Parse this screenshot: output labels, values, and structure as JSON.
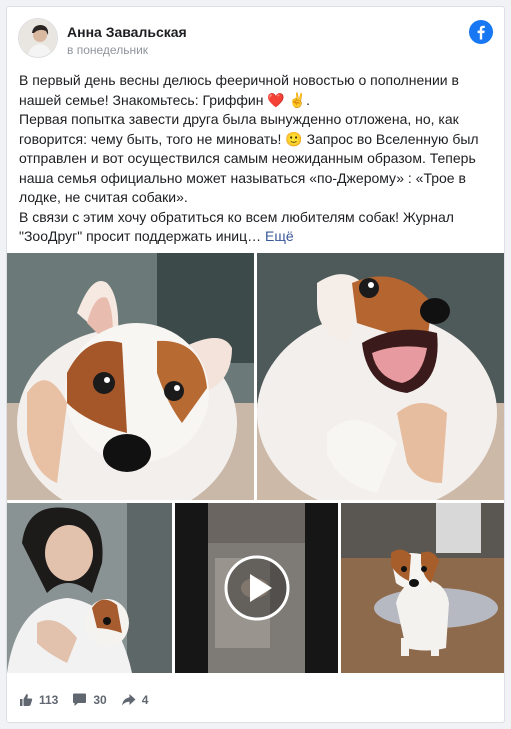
{
  "author": {
    "name": "Анна Завальская",
    "time": "в понедельник"
  },
  "post": {
    "line1": "В первый день весны делюсь фееричной новостью о пополнении в нашей семье! Знакомьтесь: Гриффин ❤️ ✌️.",
    "line2": "Первая попытка завести друга была вынужденно отложена, но, как говорится: чему быть, того не миновать! 🙂 Запрос во Вселенную был отправлен и вот осуществился самым неожиданным образом. Теперь наша семья официально может называться «по-Джерому» : «Трое в лодке, не считая собаки».",
    "line3": "В связи с этим хочу обратиться ко всем любителям собак! Журнал \"ЗооДруг\" просит поддержать иниц…",
    "more": "Ещё"
  },
  "stats": {
    "likes": "113",
    "comments": "30",
    "shares": "4"
  },
  "colors": {
    "facebook": "#1877f2",
    "link": "#385898",
    "text": "#1c1e21",
    "muted": "#90949c"
  },
  "icons": [
    "facebook-icon",
    "like-icon",
    "comment-icon",
    "share-icon",
    "play-icon"
  ]
}
